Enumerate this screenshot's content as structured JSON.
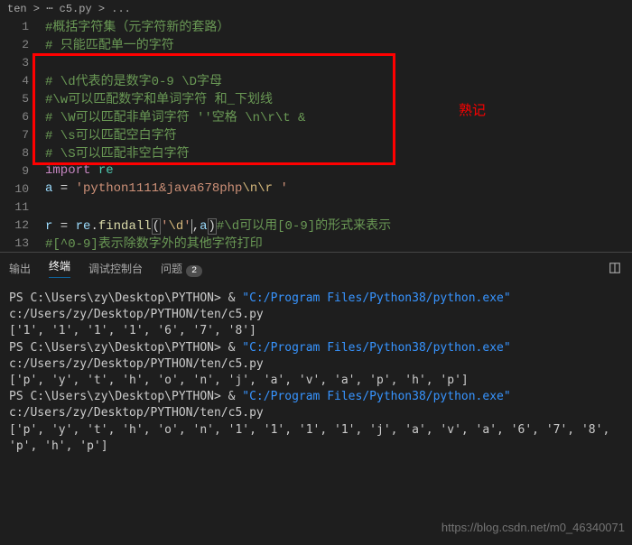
{
  "breadcrumb": "ten > ⋯ c5.py > ...",
  "annotation": "熟记",
  "lines": [
    {
      "n": "1",
      "tokens": [
        {
          "c": "cm",
          "t": "#概括字符集（元字符新的套路）"
        }
      ]
    },
    {
      "n": "2",
      "tokens": [
        {
          "c": "cm",
          "t": "# 只能匹配单一的字符"
        }
      ]
    },
    {
      "n": "3",
      "tokens": []
    },
    {
      "n": "4",
      "tokens": [
        {
          "c": "cm",
          "t": "# \\d代表的是数字0-9 \\D字母"
        }
      ]
    },
    {
      "n": "5",
      "tokens": [
        {
          "c": "cm",
          "t": "#\\w可以匹配数字和单词字符 和_下划线"
        }
      ]
    },
    {
      "n": "6",
      "tokens": [
        {
          "c": "cm",
          "t": "# \\W可以匹配非单词字符 ''空格 \\n\\r\\t &"
        }
      ]
    },
    {
      "n": "7",
      "tokens": [
        {
          "c": "cm",
          "t": "# \\s可以匹配空白字符"
        }
      ]
    },
    {
      "n": "8",
      "tokens": [
        {
          "c": "cm",
          "t": "# \\S可以匹配非空白字符"
        }
      ]
    },
    {
      "n": "9",
      "tokens": [
        {
          "c": "kw",
          "t": "import"
        },
        {
          "c": "pl",
          "t": " "
        },
        {
          "c": "mod",
          "t": "re"
        }
      ]
    },
    {
      "n": "10",
      "tokens": [
        {
          "c": "id",
          "t": "a"
        },
        {
          "c": "pl",
          "t": " = "
        },
        {
          "c": "str",
          "t": "'python1111&java678php"
        },
        {
          "c": "esc",
          "t": "\\n\\r"
        },
        {
          "c": "str",
          "t": " '"
        }
      ]
    },
    {
      "n": "11",
      "tokens": []
    },
    {
      "n": "12",
      "tokens": [
        {
          "c": "id",
          "t": "r"
        },
        {
          "c": "pl",
          "t": " = "
        },
        {
          "c": "id",
          "t": "re"
        },
        {
          "c": "pl",
          "t": "."
        },
        {
          "c": "fn",
          "t": "findall"
        },
        {
          "c": "pl brmatch",
          "t": "("
        },
        {
          "c": "str",
          "t": "'"
        },
        {
          "c": "esc",
          "t": "\\d"
        },
        {
          "c": "str cursor",
          "t": "'"
        },
        {
          "c": "pl",
          "t": ","
        },
        {
          "c": "id",
          "t": "a"
        },
        {
          "c": "pl brmatch",
          "t": ")"
        },
        {
          "c": "cm",
          "t": "#\\d可以用[0-9]的形式来表示"
        }
      ]
    },
    {
      "n": "13",
      "tokens": [
        {
          "c": "cm",
          "t": "#[^0-9]表示除数字外的其他字符打印"
        }
      ]
    }
  ],
  "tabs": {
    "output": "输出",
    "terminal": "终端",
    "debug": "调试控制台",
    "problems": "问题",
    "badge": "2"
  },
  "terminal": {
    "prompt": "PS C:\\Users\\zy\\Desktop\\PYTHON> & ",
    "exe": "\"C:/Program Files/Python38/python.exe\"",
    "script": " c:/Users/zy/Desktop/PYTHON/ten/c5.py",
    "out1": "['1', '1', '1', '1', '6', '7', '8']",
    "out2": "['p', 'y', 't', 'h', 'o', 'n', 'j', 'a', 'v', 'a', 'p', 'h', 'p']",
    "out3": "['p', 'y', 't', 'h', 'o', 'n', '1', '1', '1', '1', 'j', 'a', 'v', 'a', '6', '7', '8', 'p', 'h', 'p']"
  },
  "watermark": "https://blog.csdn.net/m0_46340071"
}
